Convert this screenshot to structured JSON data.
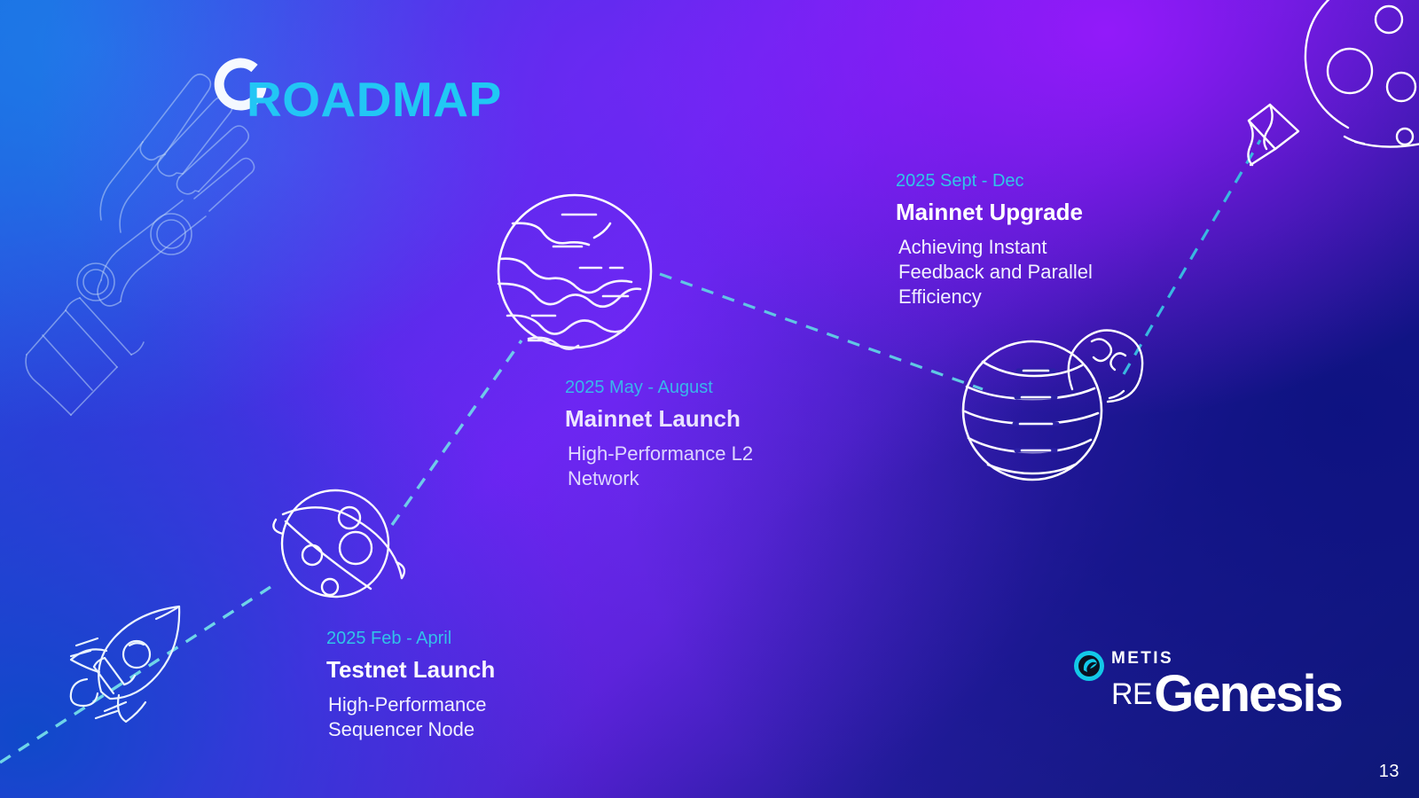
{
  "slide": {
    "title": "ROADMAP",
    "page_number": "13",
    "accent_cyan": "#1FC9F4",
    "accent_period": "#30C6E8",
    "line_color": "#6ED5E8",
    "art_stroke": "#FFFFFF"
  },
  "milestones": [
    {
      "id": "testnet-launch",
      "period": "2025 Feb - April",
      "title": "Testnet Launch",
      "description": "High-Performance\nSequencer Node"
    },
    {
      "id": "mainnet-launch",
      "period": "2025 May - August",
      "title": "Mainnet Launch",
      "description": "High-Performance L2\nNetwork"
    },
    {
      "id": "mainnet-upgrade",
      "period": "2025 Sept - Dec",
      "title": "Mainnet Upgrade",
      "description": "Achieving Instant\nFeedback and Parallel\nEfficiency"
    }
  ],
  "logo": {
    "brand": "METIS",
    "re": "RE",
    "genesis": "Genesis"
  },
  "decorations": {
    "robot_hand": "robot-hand-illustration",
    "rocket": "rocket-illustration",
    "planet_ringed": "ringed-planet-illustration",
    "planet_wavy": "wavy-planet-illustration",
    "planet_striped": "striped-planet-illustration",
    "moon_small": "small-moon-illustration",
    "moon_large": "large-cratered-moon-illustration",
    "flag": "flag-illustration"
  }
}
